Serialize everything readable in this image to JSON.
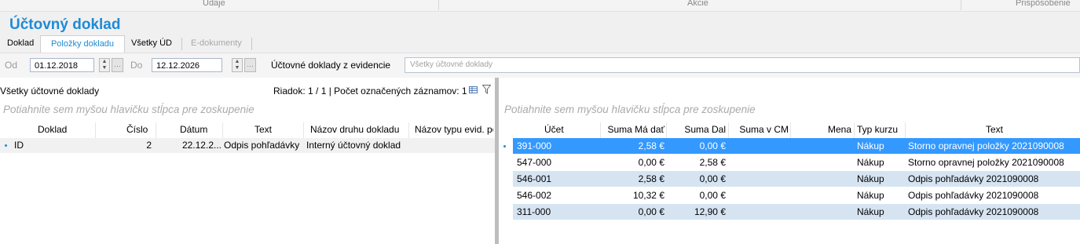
{
  "ribbon": {
    "groups": [
      "Údaje",
      "Akcie",
      "Prispôsobenie"
    ]
  },
  "page_title": "Účtovný doklad",
  "tabs": [
    {
      "label": "Doklad",
      "active": false,
      "disabled": false
    },
    {
      "label": "Položky dokladu",
      "active": true,
      "disabled": false
    },
    {
      "label": "Všetky ÚD",
      "active": false,
      "disabled": false
    },
    {
      "label": "E-dokumenty",
      "active": false,
      "disabled": true
    }
  ],
  "filter": {
    "from_label": "Od",
    "from_value": "01.12.2018",
    "to_label": "Do",
    "to_value": "12.12.2026",
    "source_label": "Účtovné doklady z evidencie",
    "source_value": "Všetky účtovné doklady"
  },
  "left": {
    "title": "Všetky účtovné doklady",
    "status": "Riadok: 1 / 1 | Počet označených záznamov: 1",
    "group_hint": "Potiahnite sem myšou hlavičku stĺpca pre zoskupenie",
    "columns": [
      "Doklad",
      "Číslo",
      "Dátum",
      "Text",
      "Názov druhu dokladu",
      "Názov typu evid. po"
    ],
    "rows": [
      {
        "doklad": "ID",
        "cislo": "2",
        "datum": "22.12.2...",
        "text": "Odpis pohľadávky",
        "druh": "Interný účtovný doklad",
        "typ": ""
      }
    ]
  },
  "right": {
    "group_hint": "Potiahnite sem myšou hlavičku stĺpca pre zoskupenie",
    "columns": [
      "Účet",
      "Suma Má dať",
      "Suma Dal",
      "Suma v CM",
      "Mena",
      "Typ kurzu",
      "Text"
    ],
    "rows": [
      {
        "ucet": "391-000",
        "ma_dat": "2,58 €",
        "dal": "0,00 €",
        "cm": "",
        "mena": "",
        "kurz": "Nákup",
        "text": "Storno opravnej položky 2021090008",
        "selected": true
      },
      {
        "ucet": "547-000",
        "ma_dat": "0,00 €",
        "dal": "2,58 €",
        "cm": "",
        "mena": "",
        "kurz": "Nákup",
        "text": "Storno opravnej položky 2021090008",
        "selected": false
      },
      {
        "ucet": "546-001",
        "ma_dat": "2,58 €",
        "dal": "0,00 €",
        "cm": "",
        "mena": "",
        "kurz": "Nákup",
        "text": "Odpis pohľadávky 2021090008",
        "selected": false
      },
      {
        "ucet": "546-002",
        "ma_dat": "10,32 €",
        "dal": "0,00 €",
        "cm": "",
        "mena": "",
        "kurz": "Nákup",
        "text": "Odpis pohľadávky 2021090008",
        "selected": false
      },
      {
        "ucet": "311-000",
        "ma_dat": "0,00 €",
        "dal": "12,90 €",
        "cm": "",
        "mena": "",
        "kurz": "Nákup",
        "text": "Odpis pohľadávky 2021090008",
        "selected": false
      }
    ]
  },
  "colors": {
    "accent": "#1f8ad6",
    "selected_row": "#3399ff",
    "alt_row": "#d6e4f2"
  }
}
